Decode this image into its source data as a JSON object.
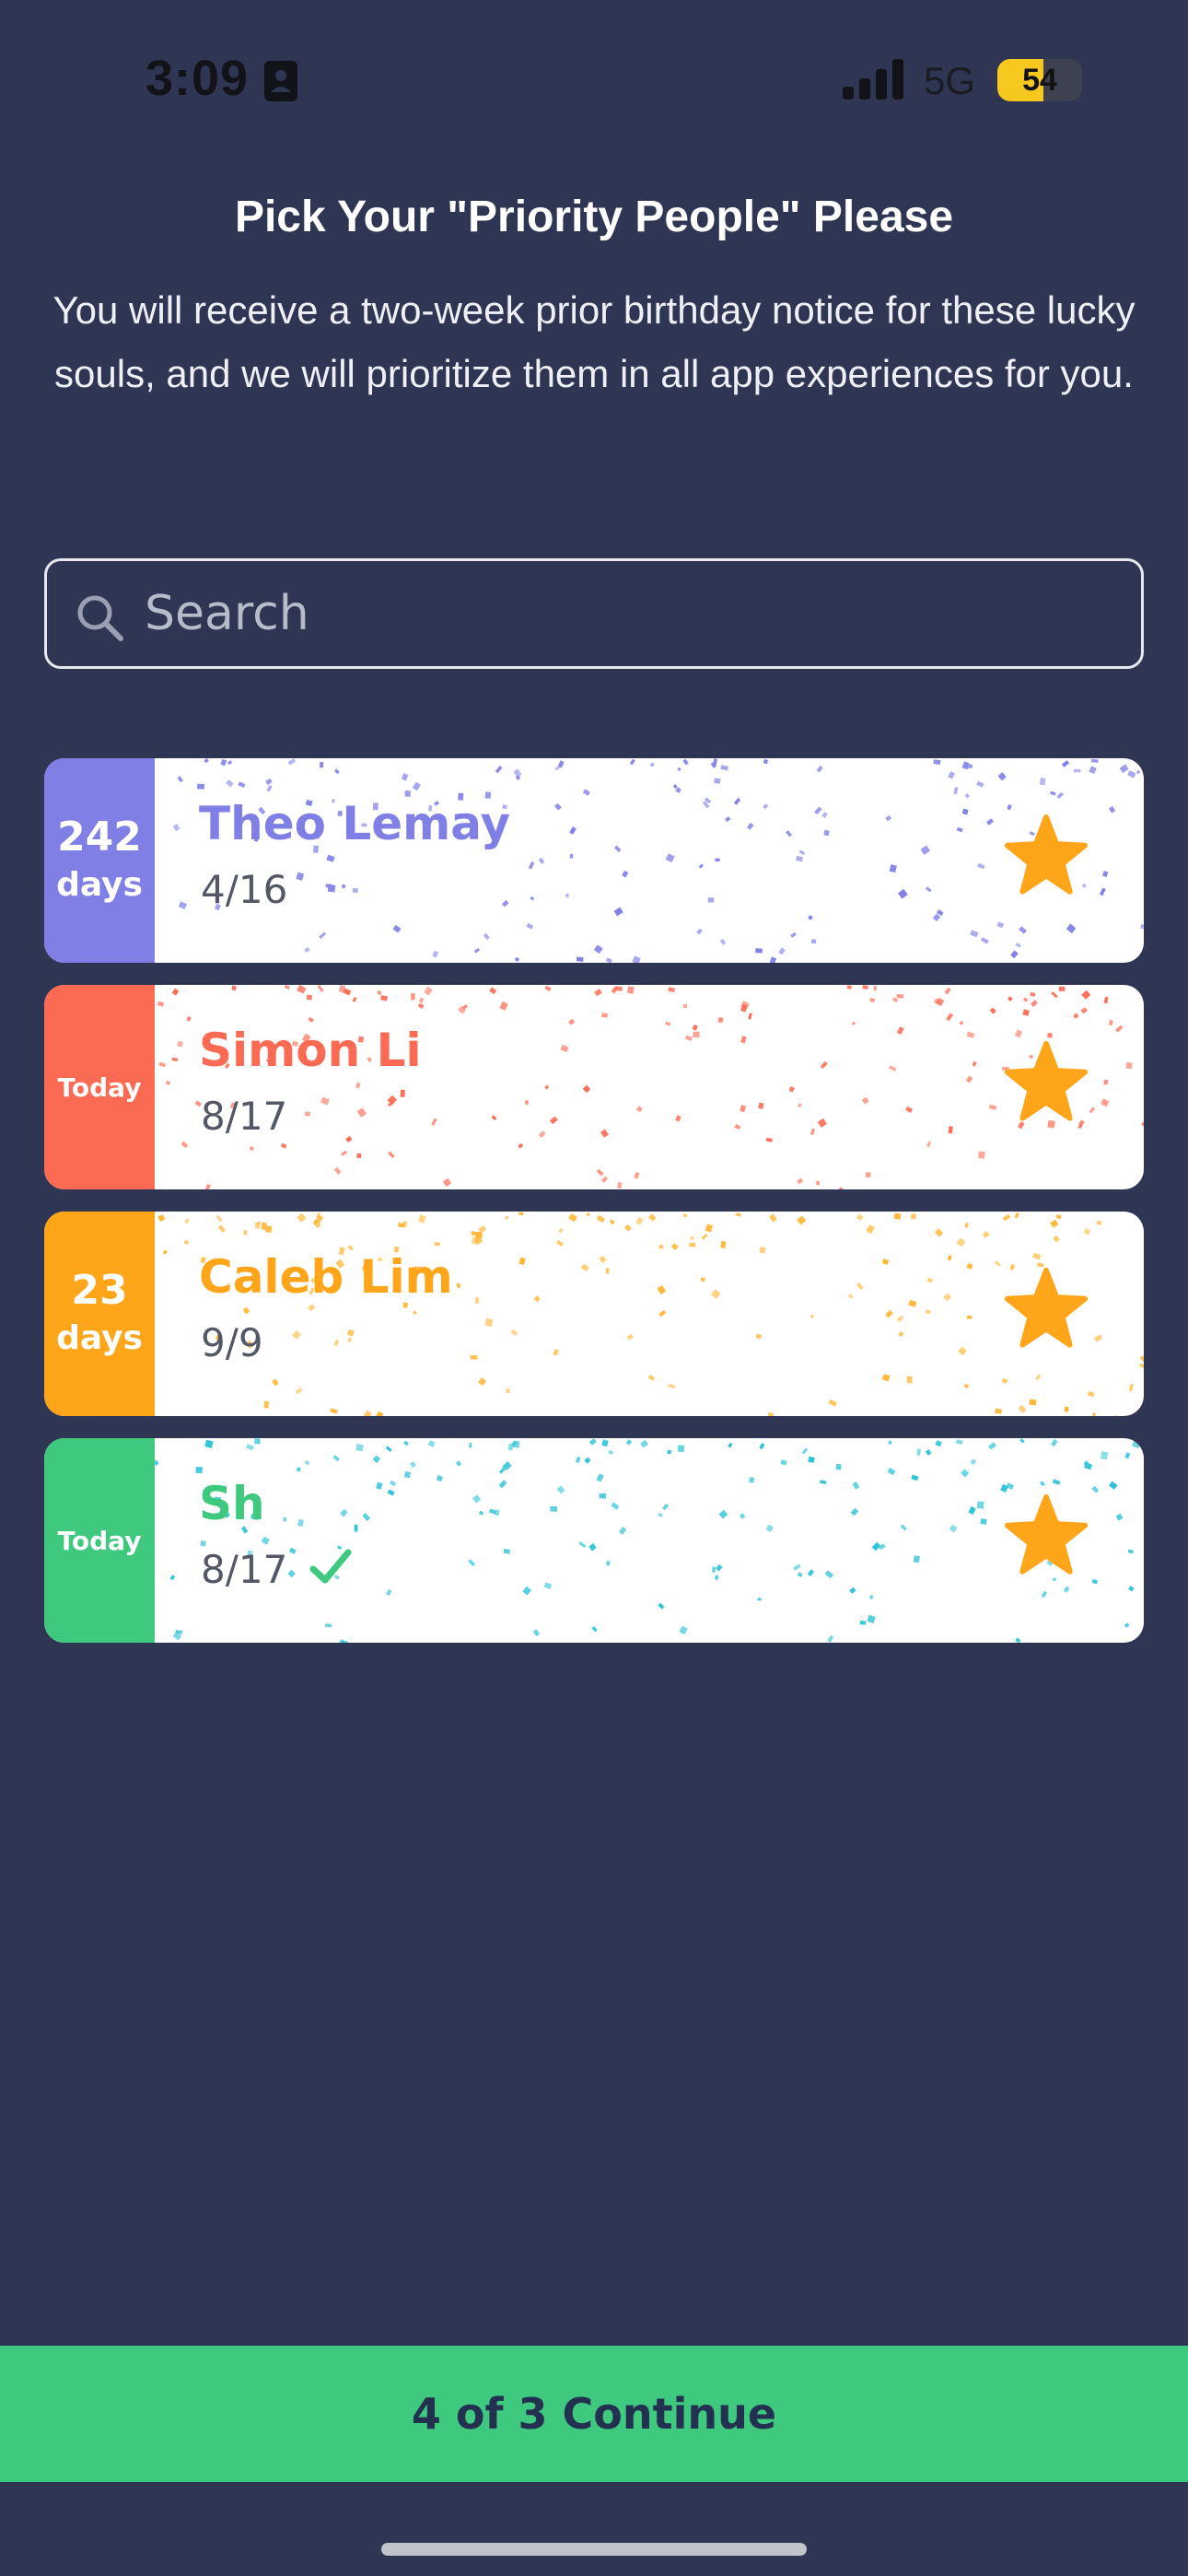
{
  "status_bar": {
    "time": "3:09",
    "network": "5G",
    "battery": "54",
    "battery_level": 0.54,
    "battery_color": "#f7c81e"
  },
  "header": {
    "title": "Pick Your \"Priority People\" Please",
    "subtitle": "You will receive a two-week prior birthday notice for these lucky souls, and we will prioritize them in all app experiences for you."
  },
  "search": {
    "placeholder": "Search",
    "value": ""
  },
  "people": [
    {
      "badge_num": "242",
      "badge_unit": "days",
      "name": "Theo Lemay",
      "date": "4/16",
      "color": "#7f7fe6",
      "starred": true,
      "checked": false
    },
    {
      "badge_num": "",
      "badge_unit": "Today",
      "name": "Simon Li",
      "date": "8/17",
      "color": "#fb6a52",
      "starred": true,
      "checked": false
    },
    {
      "badge_num": "23",
      "badge_unit": "days",
      "name": "Caleb Lim",
      "date": "9/9",
      "color": "#ffa51a",
      "starred": true,
      "checked": false
    },
    {
      "badge_num": "",
      "badge_unit": "Today",
      "name": "Sh",
      "date": "8/17",
      "color": "#3ec97f",
      "starred": true,
      "checked": true
    }
  ],
  "star_color": "#ffa51a",
  "confetti_colors": [
    "#7f7fe6",
    "#fb6a52",
    "#ffb533",
    "#2bc2d6"
  ],
  "continue_label": "4 of 3 Continue"
}
